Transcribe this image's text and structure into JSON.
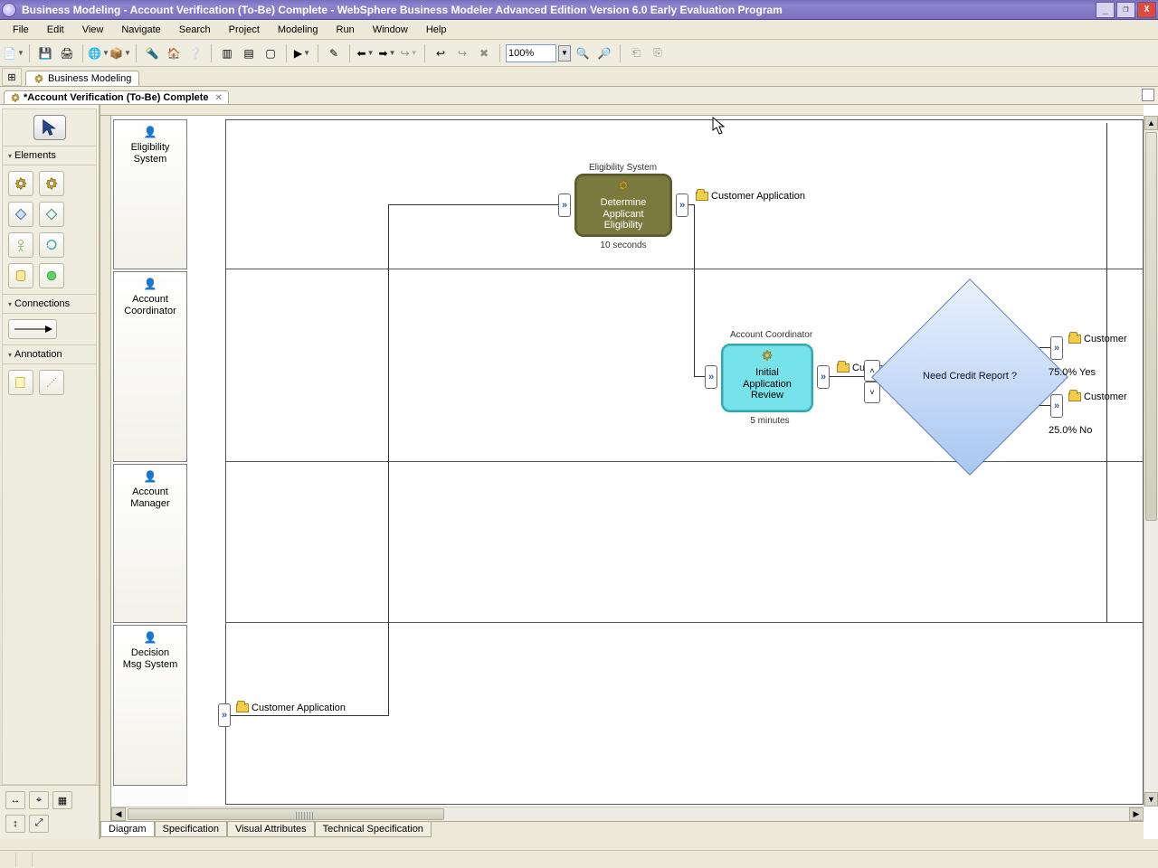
{
  "window": {
    "title": "Business Modeling - Account Verification (To-Be) Complete - WebSphere Business Modeler Advanced Edition Version 6.0 Early Evaluation Program"
  },
  "menu": {
    "file": "File",
    "edit": "Edit",
    "view": "View",
    "navigate": "Navigate",
    "search": "Search",
    "project": "Project",
    "modeling": "Modeling",
    "run": "Run",
    "window": "Window",
    "help": "Help"
  },
  "toolbar": {
    "zoom": "100%"
  },
  "perspective": {
    "tab": "Business Modeling"
  },
  "editor_tab": {
    "label": "*Account Verification (To-Be) Complete"
  },
  "palette": {
    "elements_title": "Elements",
    "connections_title": "Connections",
    "annotation_title": "Annotation"
  },
  "lanes": {
    "lane1": "Eligibility\nSystem",
    "lane2": "Account\nCoordinator",
    "lane3": "Account\nManager",
    "lane4": "Decision\nMsg System"
  },
  "diagram": {
    "swim1_label": "Eligibility System",
    "task1": "Determine\nApplicant\nEligibility",
    "task1_duration": "10 seconds",
    "data_custapp": "Customer Application",
    "swim2_label": "Account Coordinator",
    "task2": "Initial\nApplication\nReview",
    "task2_duration": "5 minutes",
    "decision": "Need Credit Report ?",
    "prob_yes": "75.0% Yes",
    "prob_no": "25.0% No",
    "data_customer_cut": "Customer"
  },
  "bottom_tabs": {
    "t1": "Diagram",
    "t2": "Specification",
    "t3": "Visual Attributes",
    "t4": "Technical Specification"
  }
}
